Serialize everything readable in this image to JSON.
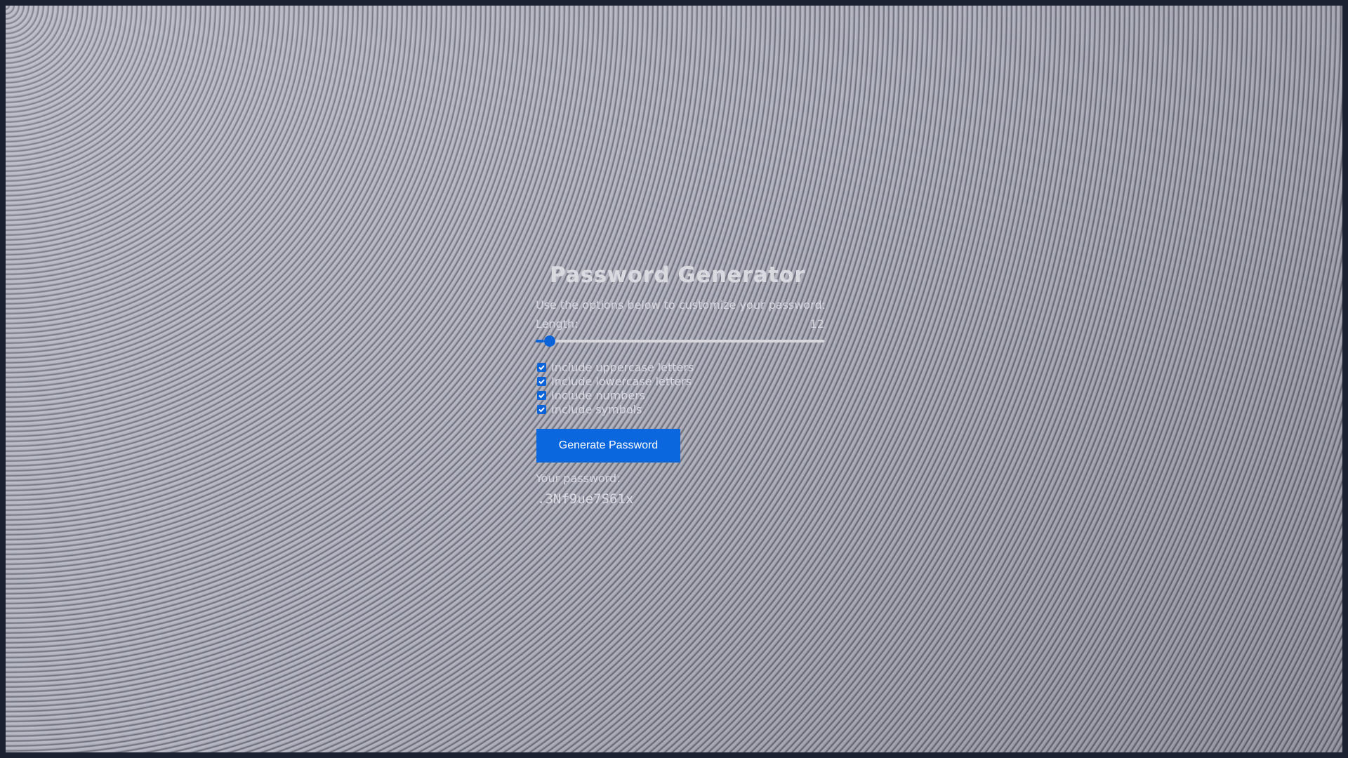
{
  "app": {
    "title": "Password Generator",
    "subtitle": "Use the options below to customize your password:"
  },
  "length": {
    "label": "Length:",
    "value": "12",
    "slider_fraction": 0.03
  },
  "options": [
    {
      "label": "Include uppercase letters",
      "checked": true
    },
    {
      "label": "Include lowercase letters",
      "checked": true
    },
    {
      "label": "Include numbers",
      "checked": true
    },
    {
      "label": "Include symbols",
      "checked": true
    }
  ],
  "actions": {
    "generate_label": "Generate Password"
  },
  "result": {
    "label": "Your password:",
    "value": ".3Nf9ue7S61x"
  },
  "colors": {
    "accent": "#0a67de",
    "text": "#d6d7de"
  },
  "icons": {
    "checkbox": "checkmark-icon"
  }
}
